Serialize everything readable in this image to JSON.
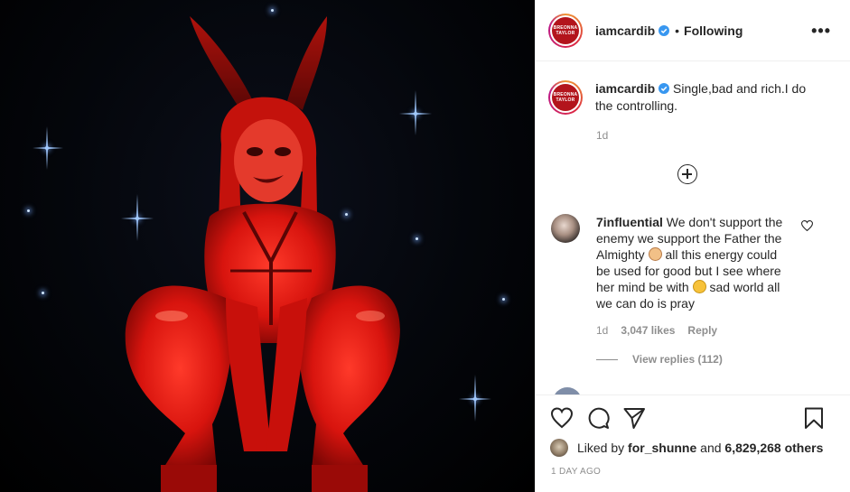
{
  "post": {
    "brand_color": "#b3141c",
    "avatar_logo_lines": [
      "BREONNA",
      "TAYLOR"
    ]
  },
  "header": {
    "username": "iamcardib",
    "separator": "•",
    "follow_status": "Following",
    "more_icon": "more-horizontal-icon",
    "more_glyph": "•••"
  },
  "caption": {
    "username": "iamcardib",
    "text": "Single,bad and rich.I do the controlling.",
    "time": "1d"
  },
  "comment": {
    "username": "7influential",
    "text_part1": "We don't support the enemy we support the Father the Almighty",
    "text_part2": "all this energy could be used for good but I see where her mind be with",
    "text_part3": "sad world all we can do is pray",
    "emoji_1": "praying-hands",
    "emoji_2": "sad-face",
    "time": "1d",
    "likes": "3,047 likes",
    "reply_label": "Reply",
    "view_replies": "View replies (112)"
  },
  "likes": {
    "prefix": "Liked by",
    "user": "for_shunne",
    "joiner": "and",
    "count": "6,829,268 others"
  },
  "posted_ago": "1 DAY AGO",
  "colors": {
    "verified_blue": "#3897f0",
    "text": "#262626",
    "muted": "#8e8e8e",
    "divider": "#efefef"
  }
}
